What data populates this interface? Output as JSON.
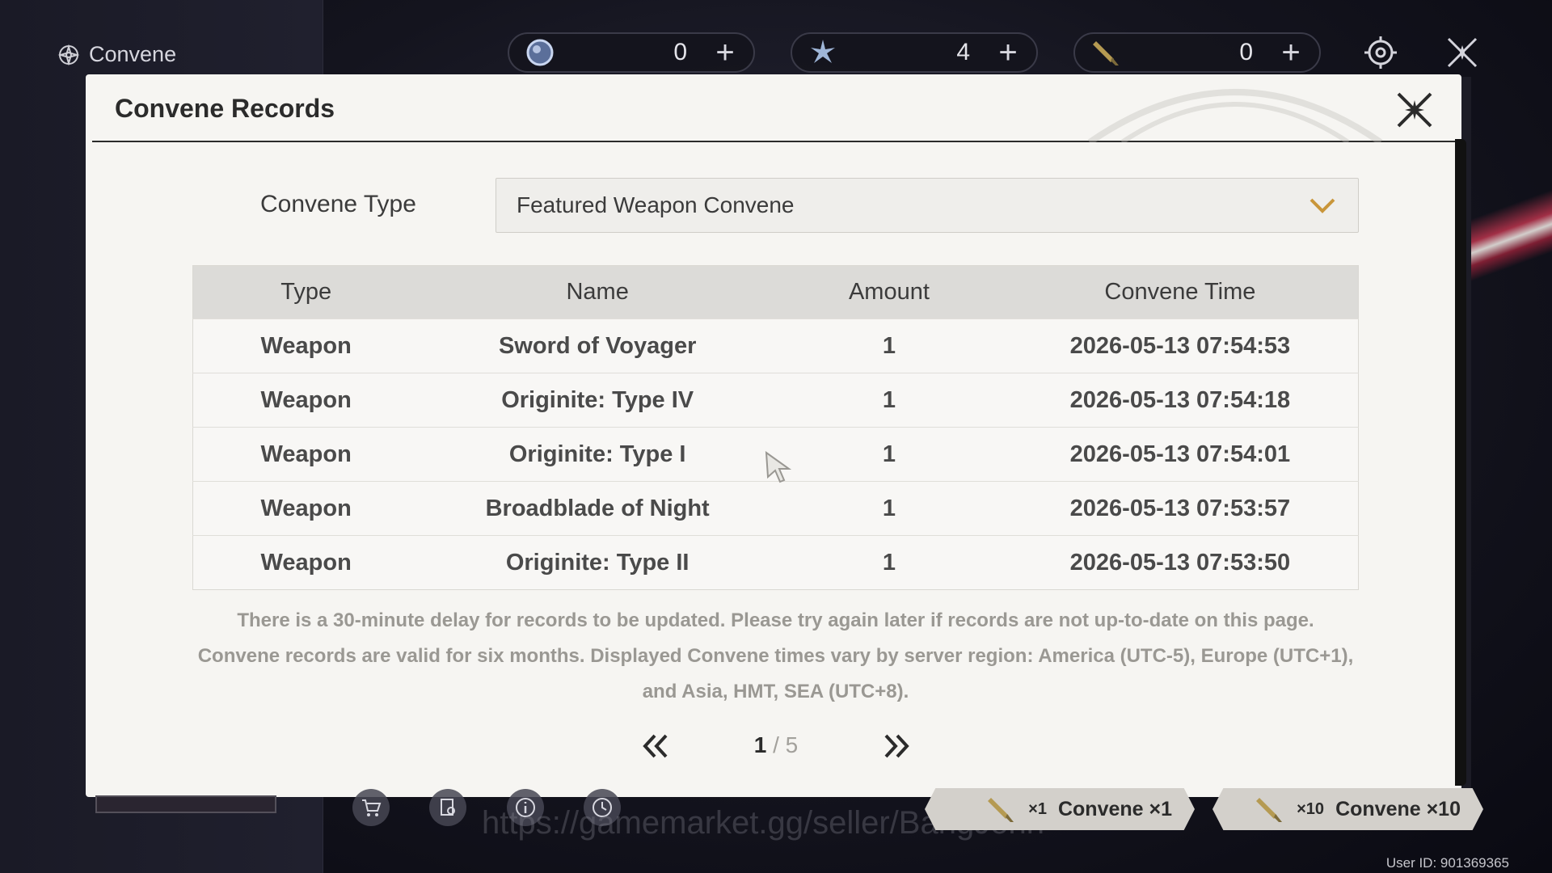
{
  "topbar": {
    "title": "Convene",
    "currencies": [
      {
        "icon": "astrite-orb-icon",
        "value": "0",
        "plus": "+"
      },
      {
        "icon": "radiant-tide-icon",
        "value": "4",
        "plus": "+"
      },
      {
        "icon": "forging-tide-icon",
        "value": "0",
        "plus": "+"
      }
    ]
  },
  "modal": {
    "title": "Convene Records",
    "type_label": "Convene Type",
    "type_value": "Featured Weapon Convene",
    "table": {
      "headers": [
        "Type",
        "Name",
        "Amount",
        "Convene Time"
      ],
      "rows": [
        [
          "Weapon",
          "Sword of Voyager",
          "1",
          "2026-05-13 07:54:53"
        ],
        [
          "Weapon",
          "Originite: Type IV",
          "1",
          "2026-05-13 07:54:18"
        ],
        [
          "Weapon",
          "Originite: Type I",
          "1",
          "2026-05-13 07:54:01"
        ],
        [
          "Weapon",
          "Broadblade of Night",
          "1",
          "2026-05-13 07:53:57"
        ],
        [
          "Weapon",
          "Originite: Type II",
          "1",
          "2026-05-13 07:53:50"
        ]
      ]
    },
    "note_lines": [
      "There is a 30-minute delay for records to be updated. Please try again later if records are not up-to-date on this page.",
      "Convene records are valid for six months. Displayed Convene times vary by server region: America (UTC-5), Europe (UTC+1),",
      "and Asia, HMT, SEA (UTC+8)."
    ],
    "pagination": {
      "current": "1",
      "separator": " / ",
      "total": "5"
    }
  },
  "bottom": {
    "watermark": "https://gamemarket.gg/seller/BangJohn",
    "convene_x1": {
      "count": "×1",
      "label": "Convene ×1"
    },
    "convene_x10": {
      "count": "×10",
      "label": "Convene ×10"
    },
    "user_id": "User ID: 901369365"
  }
}
